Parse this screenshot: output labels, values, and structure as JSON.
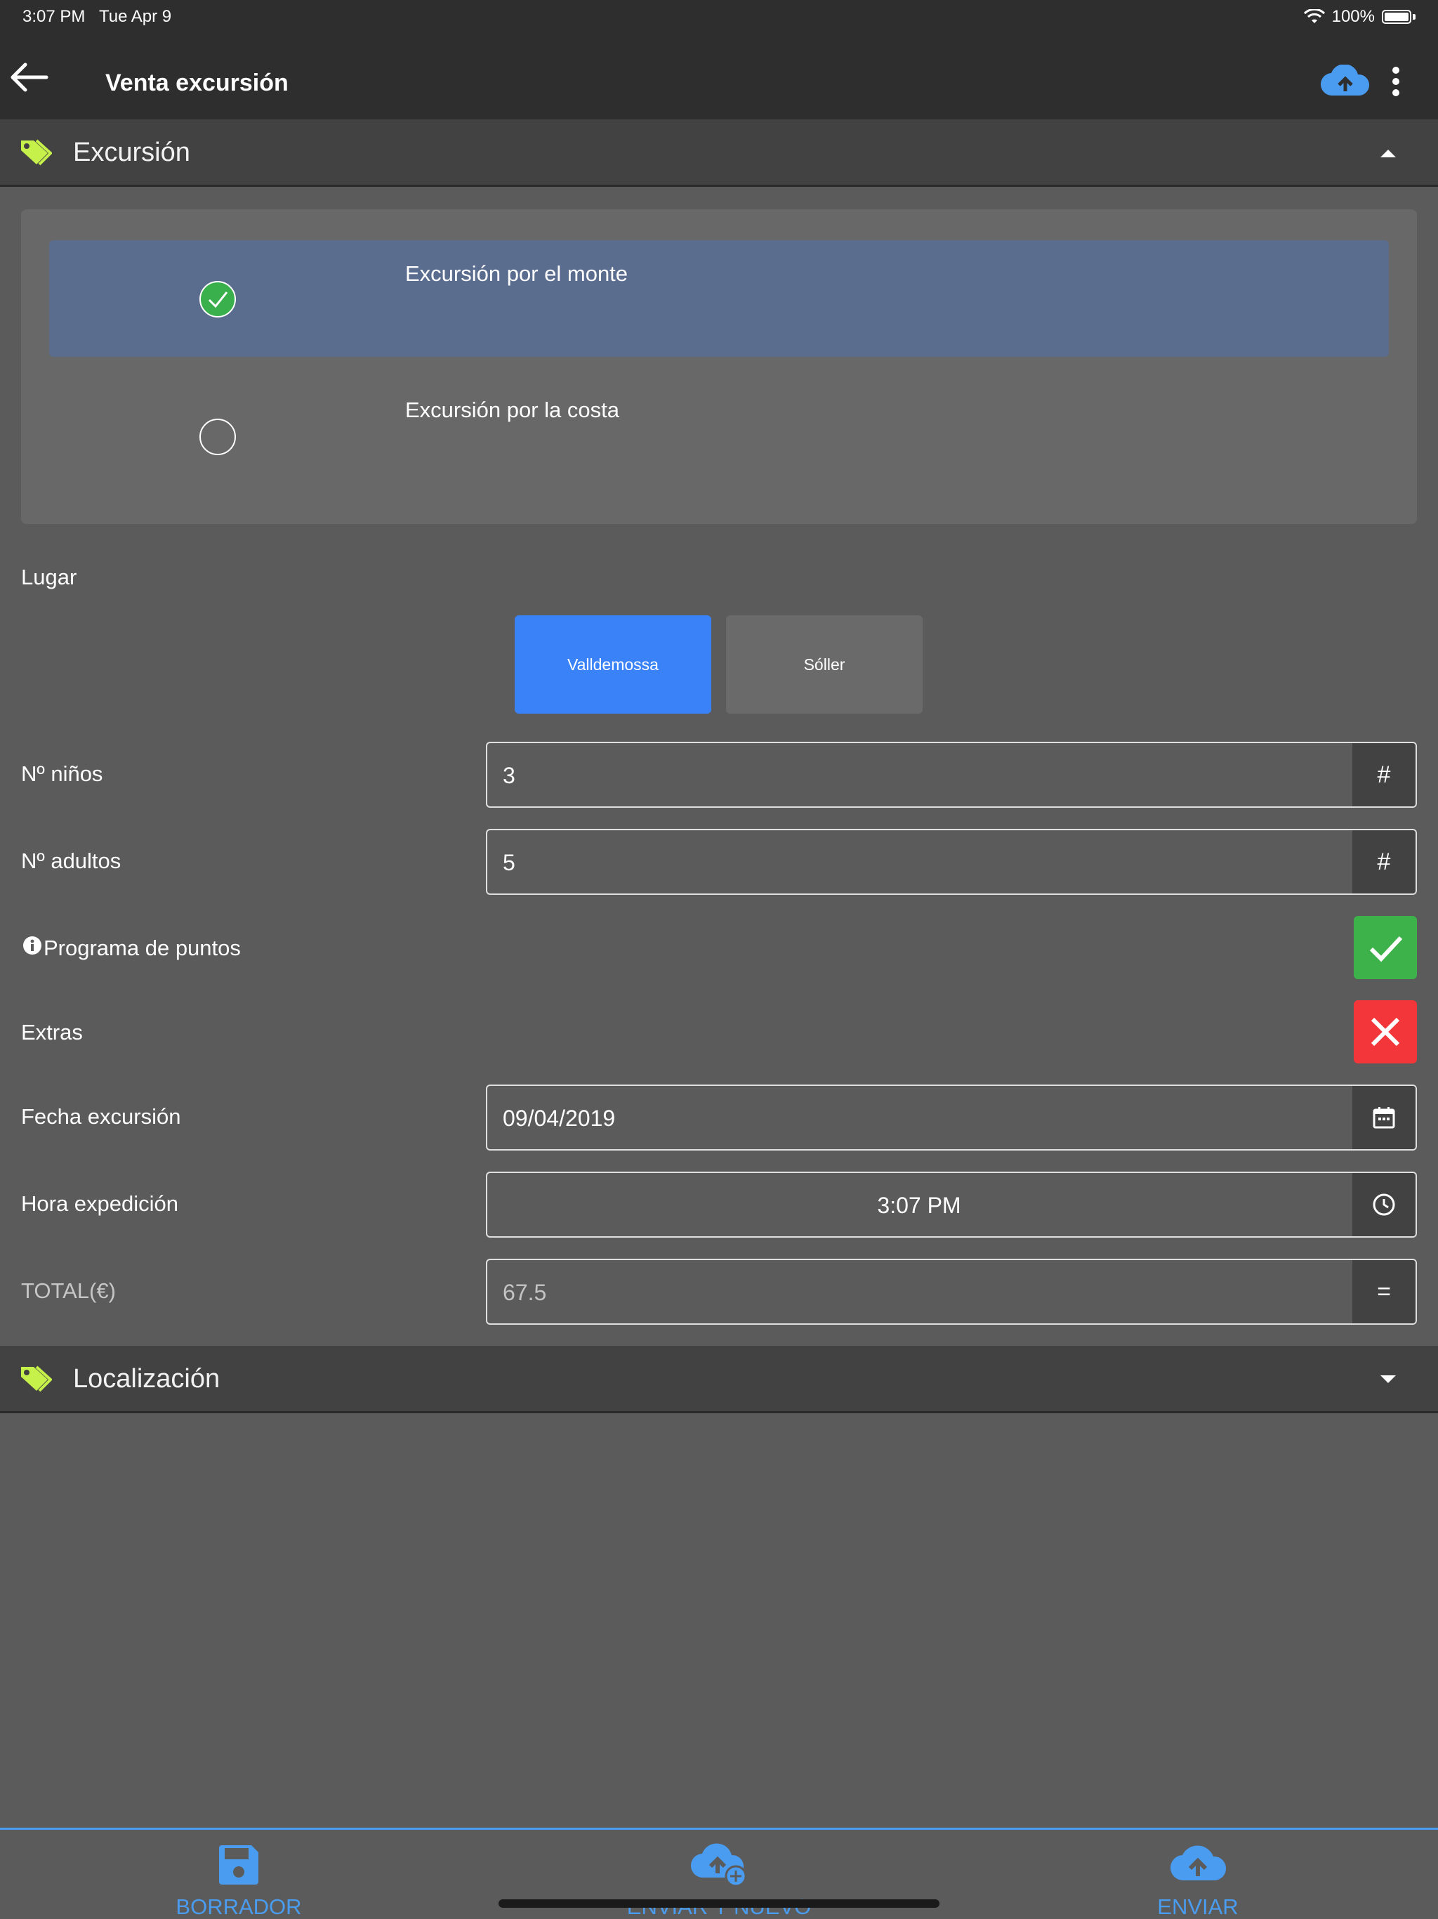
{
  "status_bar": {
    "time": "3:07 PM",
    "date": "Tue Apr 9",
    "battery": "100%"
  },
  "app_bar": {
    "title": "Venta excursión",
    "back_icon": "arrow-left-icon",
    "upload_icon": "cloud-upload-icon",
    "menu_icon": "more-vertical-icon"
  },
  "sections": {
    "excursion": {
      "title": "Excursión",
      "expanded": true
    },
    "localizacion": {
      "title": "Localización",
      "expanded": false
    }
  },
  "excursion_options": [
    {
      "label": "Excursión por el monte",
      "selected": true
    },
    {
      "label": "Excursión por la costa",
      "selected": false
    }
  ],
  "lugar": {
    "label": "Lugar",
    "options": [
      "Valldemossa",
      "Sóller"
    ],
    "selected": "Valldemossa"
  },
  "fields": {
    "ninos": {
      "label": "Nº niños",
      "value": "3",
      "suffix": "#"
    },
    "adultos": {
      "label": "Nº adultos",
      "value": "5",
      "suffix": "#"
    },
    "programa": {
      "label": "Programa de puntos",
      "value": true
    },
    "extras": {
      "label": "Extras",
      "value": false
    },
    "fecha": {
      "label": "Fecha excursión",
      "value": "09/04/2019"
    },
    "hora": {
      "label": "Hora expedición",
      "value": "3:07 PM"
    },
    "total": {
      "label": "TOTAL(€)",
      "value": "67.5",
      "suffix": "="
    }
  },
  "bottom_bar": {
    "borrador": "BORRADOR",
    "enviar_nuevo": "ENVIAR Y NUEVO",
    "enviar": "ENVIAR"
  },
  "colors": {
    "accent_blue": "#3a82f7",
    "link_blue": "#4a9cf0",
    "tag_green": "#c6f04a",
    "ok_green": "#3db24a",
    "error_red": "#f2363a",
    "selected_row": "#5b6d8f"
  }
}
